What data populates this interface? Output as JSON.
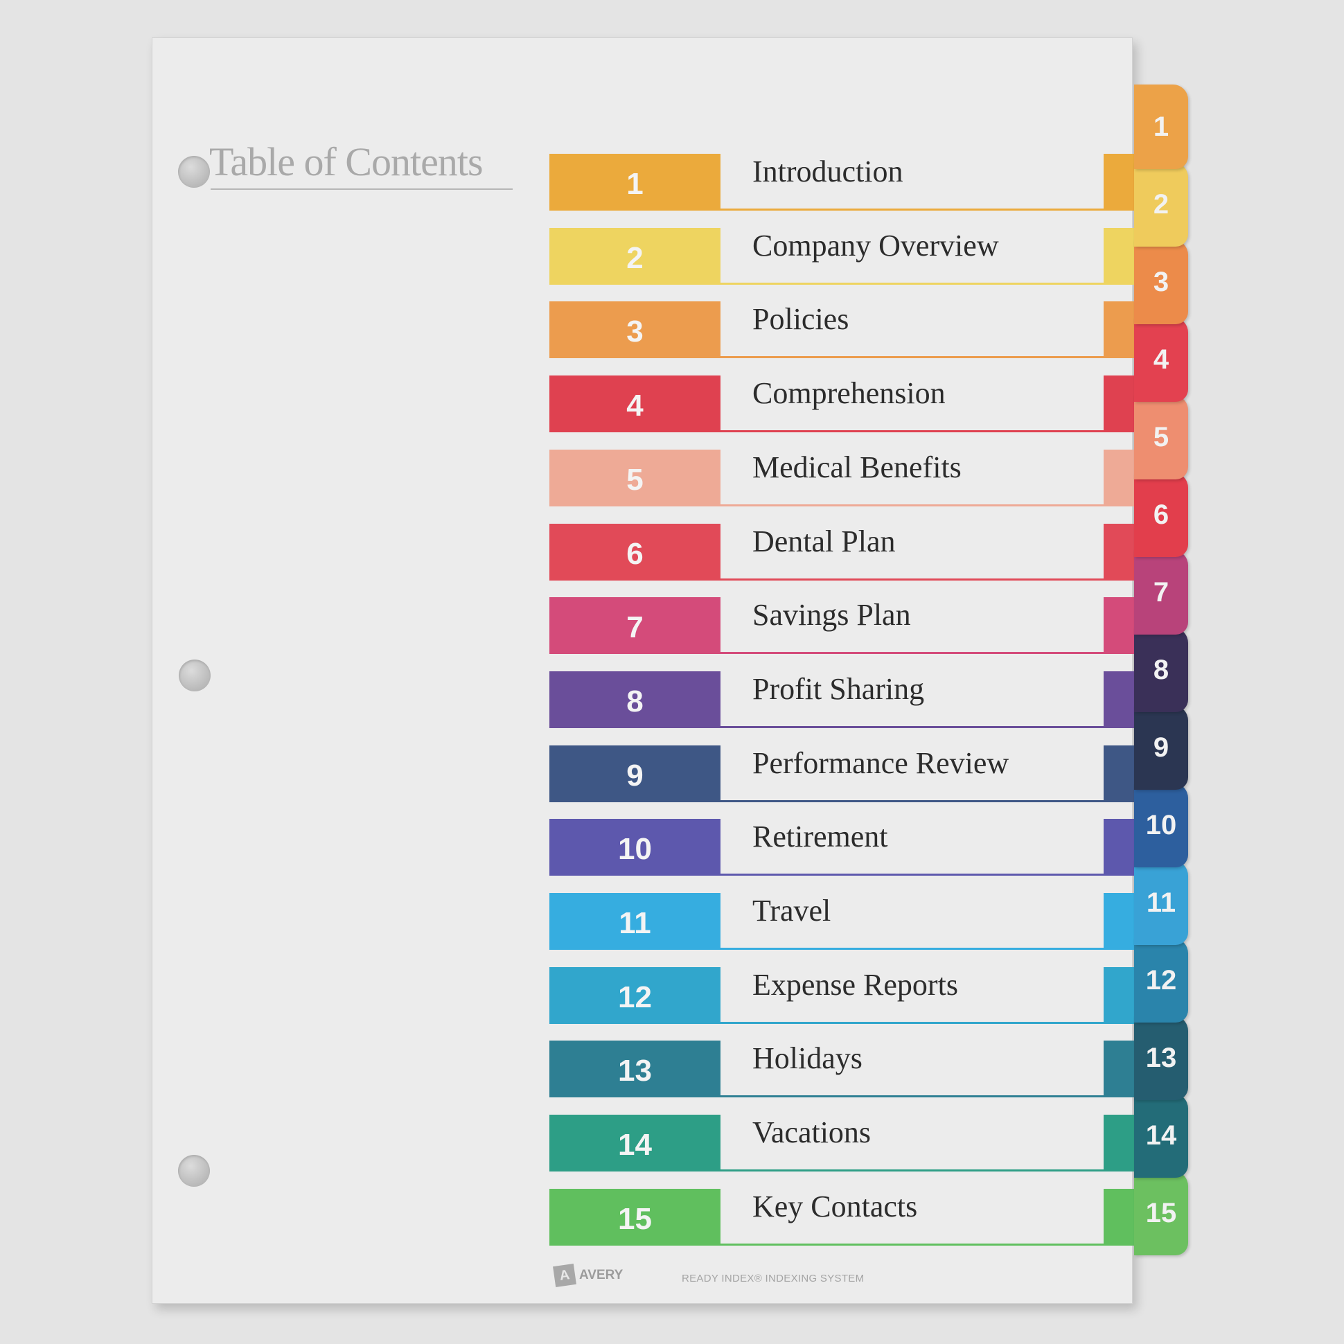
{
  "document": {
    "title": "Table of Contents",
    "entries": [
      {
        "number": "1",
        "label": "Introduction",
        "color": "#ebaa3c"
      },
      {
        "number": "2",
        "label": "Company Overview",
        "color": "#eed460"
      },
      {
        "number": "3",
        "label": "Policies",
        "color": "#ec9c4e"
      },
      {
        "number": "4",
        "label": "Comprehension",
        "color": "#df4150"
      },
      {
        "number": "5",
        "label": "Medical Benefits",
        "color": "#eeaa96"
      },
      {
        "number": "6",
        "label": "Dental Plan",
        "color": "#e14a58"
      },
      {
        "number": "7",
        "label": "Savings Plan",
        "color": "#d44b7a"
      },
      {
        "number": "8",
        "label": "Profit Sharing",
        "color": "#6a4e9a"
      },
      {
        "number": "9",
        "label": "Performance Review",
        "color": "#3e5785"
      },
      {
        "number": "10",
        "label": "Retirement",
        "color": "#5d58ad"
      },
      {
        "number": "11",
        "label": "Travel",
        "color": "#36ade0"
      },
      {
        "number": "12",
        "label": "Expense Reports",
        "color": "#31a6cc"
      },
      {
        "number": "13",
        "label": "Holidays",
        "color": "#2e7f93"
      },
      {
        "number": "14",
        "label": "Vacations",
        "color": "#2d9e86"
      },
      {
        "number": "15",
        "label": "Key Contacts",
        "color": "#60bf5e"
      }
    ]
  },
  "tabs": [
    {
      "number": "1",
      "color": "#eca248"
    },
    {
      "number": "2",
      "color": "#efcb5c"
    },
    {
      "number": "3",
      "color": "#ec8b4a"
    },
    {
      "number": "4",
      "color": "#e34150"
    },
    {
      "number": "5",
      "color": "#ee8e70"
    },
    {
      "number": "6",
      "color": "#e23e4c"
    },
    {
      "number": "7",
      "color": "#b8437a"
    },
    {
      "number": "8",
      "color": "#3a3058"
    },
    {
      "number": "9",
      "color": "#2b3652"
    },
    {
      "number": "10",
      "color": "#2d5f9e"
    },
    {
      "number": "11",
      "color": "#39a2d6"
    },
    {
      "number": "12",
      "color": "#2a84ab"
    },
    {
      "number": "13",
      "color": "#255d70"
    },
    {
      "number": "14",
      "color": "#236c78"
    },
    {
      "number": "15",
      "color": "#6cc060"
    }
  ],
  "footer": {
    "brand": "AVERY",
    "brand_mark": "A",
    "system_text": "READY INDEX® INDEXING SYSTEM"
  }
}
